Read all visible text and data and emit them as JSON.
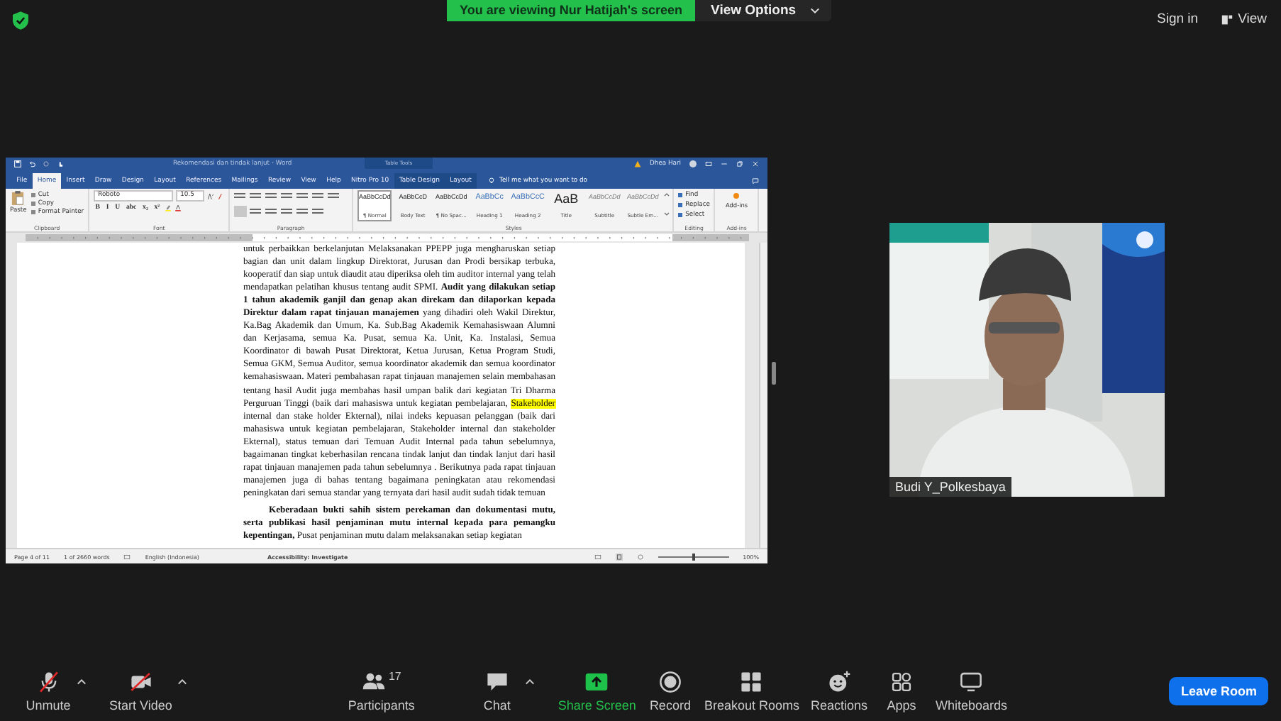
{
  "top_bar": {
    "viewing_banner": "You are viewing Nur Hatijah's screen",
    "view_options": "View Options",
    "sign_in": "Sign in",
    "view": "View"
  },
  "shared_window": {
    "title": "Rekomendasi dan tindak lanjut - Word",
    "context_title": "Table Tools",
    "user": "Dhea Hari",
    "tabs": [
      {
        "label": "File",
        "selected": false
      },
      {
        "label": "Home",
        "selected": true
      },
      {
        "label": "Insert",
        "selected": false
      },
      {
        "label": "Draw",
        "selected": false
      },
      {
        "label": "Design",
        "selected": false
      },
      {
        "label": "Layout",
        "selected": false
      },
      {
        "label": "References",
        "selected": false
      },
      {
        "label": "Mailings",
        "selected": false
      },
      {
        "label": "Review",
        "selected": false
      },
      {
        "label": "View",
        "selected": false
      },
      {
        "label": "Help",
        "selected": false
      },
      {
        "label": "Nitro Pro 10",
        "selected": false
      },
      {
        "label": "Table Design",
        "selected": false
      },
      {
        "label": "Layout",
        "selected": false
      }
    ],
    "tell_me": "Tell me what you want to do",
    "clipboard": {
      "paste": "Paste",
      "items": [
        "Cut",
        "Copy",
        "Format Painter"
      ],
      "label": "Clipboard"
    },
    "font": {
      "family": "Roboto",
      "size": "10.5",
      "buttons": [
        "B",
        "I",
        "U",
        "abc",
        "x₂",
        "x²"
      ],
      "label": "Font"
    },
    "paragraph": {
      "label": "Paragraph"
    },
    "styles": {
      "label": "Styles",
      "items": [
        {
          "sample": "AaBbCcDd",
          "name": "¶ Normal",
          "kind": "normal",
          "selected": true
        },
        {
          "sample": "AaBbCcD",
          "name": "Body Text",
          "kind": "normal",
          "selected": false
        },
        {
          "sample": "AaBbCcDd",
          "name": "¶ No Spac...",
          "kind": "normal",
          "selected": false
        },
        {
          "sample": "AaBbCc",
          "name": "Heading 1",
          "kind": "heading",
          "selected": false
        },
        {
          "sample": "AaBbCcC",
          "name": "Heading 2",
          "kind": "heading",
          "selected": false
        },
        {
          "sample": "AaB",
          "name": "Title",
          "kind": "title",
          "selected": false
        },
        {
          "sample": "AaBbCcDd",
          "name": "Subtitle",
          "kind": "subtle",
          "selected": false
        },
        {
          "sample": "AaBbCcDd",
          "name": "Subtle Em...",
          "kind": "subtle",
          "selected": false
        }
      ]
    },
    "editing": {
      "label": "Editing",
      "items": [
        "Find",
        "Replace",
        "Select"
      ]
    },
    "add_ins": {
      "button": "Add-ins",
      "label": "Add-ins"
    },
    "document": {
      "paragraphs": [
        {
          "indent": false,
          "segments": [
            {
              "text": "untuk perbaikkan berkelanjutan Melaksanakan PPEPP juga mengharuskan setiap bagian dan unit dalam lingkup Direktorat, Jurusan dan Prodi bersikap terbuka, kooperatif dan siap untuk diaudit atau diperiksa oleh tim auditor internal yang telah mendapatkan pelatihan khusus tentang audit SPMI. ",
              "bold": false,
              "highlight": false
            },
            {
              "text": "Audit yang dilakukan setiap 1 tahun akademik ganjil dan genap akan direkam dan dilaporkan kepada Direktur dalam rapat tinjauan manajemen",
              "bold": true,
              "highlight": false
            },
            {
              "text": " yang dihadiri oleh Wakil Direktur, Ka.Bag Akademik dan Umum, Ka. Sub.Bag Akademik Kemahasiswaan Alumni dan Kerjasama, semua Ka. Pusat, semua Ka. Unit, Ka. Instalasi, Semua Koordinator di bawah Pusat Direktorat, Ketua Jurusan, Ketua Program Studi, Semua GKM, Semua Auditor, semua koordinator akademik dan semua koordinator kemahasiswaan. Materi pembahasan rapat tinjauan manajemen selain membahasan tentang hasil Audit juga membahas hasil umpan balik dari kegiatan Tri Dharma Perguruan Tinggi (baik dari mahasiswa untuk kegiatan pembelajaran, ",
              "bold": false,
              "highlight": false
            },
            {
              "text": "Stakeholder",
              "bold": false,
              "highlight": true
            },
            {
              "text": " internal dan stake holder Ekternal), nilai indeks kepuasan pelanggan (baik dari mahasiswa untuk kegiatan pembelajaran, Stakeholder internal dan stakeholder Ekternal), status temuan dari Temuan Audit Internal pada tahun sebelumnya, bagaimanan tingkat keberhasilan rencana tindak lanjut dan tindak lanjut dari hasil rapat tinjauan manajemen pada tahun sebelumnya . Berikutnya pada rapat tinjauan manajemen juga di bahas tentang bagaimana peningkatan atau rekomendasi peningkatan dari semua standar yang ternyata dari hasil audit sudah tidak temuan",
              "bold": false,
              "highlight": false
            }
          ]
        },
        {
          "indent": true,
          "segments": [
            {
              "text": "Keberadaan bukti sahih sistem perekaman dan dokumentasi mutu, serta publikasi hasil penjaminan mutu internal kepada para pemangku kepentingan,",
              "bold": true,
              "highlight": false
            },
            {
              "text": " Pusat penjaminan mutu dalam melaksanakan setiap kegiatan",
              "bold": false,
              "highlight": false
            }
          ]
        }
      ]
    },
    "status_bar": {
      "page": "Page 4 of 11",
      "words": "1 of 2660 words",
      "language": "English (Indonesia)",
      "accessibility": "Accessibility: Investigate",
      "zoom": "100%",
      "zoom_slider": {
        "level": 0.5
      }
    }
  },
  "participant_video": {
    "name": "Budi Y_Polkesbaya"
  },
  "toolbar": {
    "items": [
      {
        "kind": "mic",
        "label": "Unmute",
        "has_menu": true
      },
      {
        "kind": "video",
        "label": "Start Video",
        "has_menu": true
      },
      {
        "kind": "participants",
        "label": "Participants",
        "count": "17",
        "has_menu": false
      },
      {
        "kind": "chat",
        "label": "Chat",
        "has_menu": true
      },
      {
        "kind": "share",
        "label": "Share Screen",
        "has_menu": false
      },
      {
        "kind": "record",
        "label": "Record",
        "has_menu": false
      },
      {
        "kind": "breakout",
        "label": "Breakout Rooms",
        "has_menu": false
      },
      {
        "kind": "reactions",
        "label": "Reactions",
        "has_menu": false
      },
      {
        "kind": "apps",
        "label": "Apps",
        "has_menu": false
      },
      {
        "kind": "whiteboards",
        "label": "Whiteboards",
        "has_menu": false
      }
    ],
    "leave": "Leave Room"
  }
}
